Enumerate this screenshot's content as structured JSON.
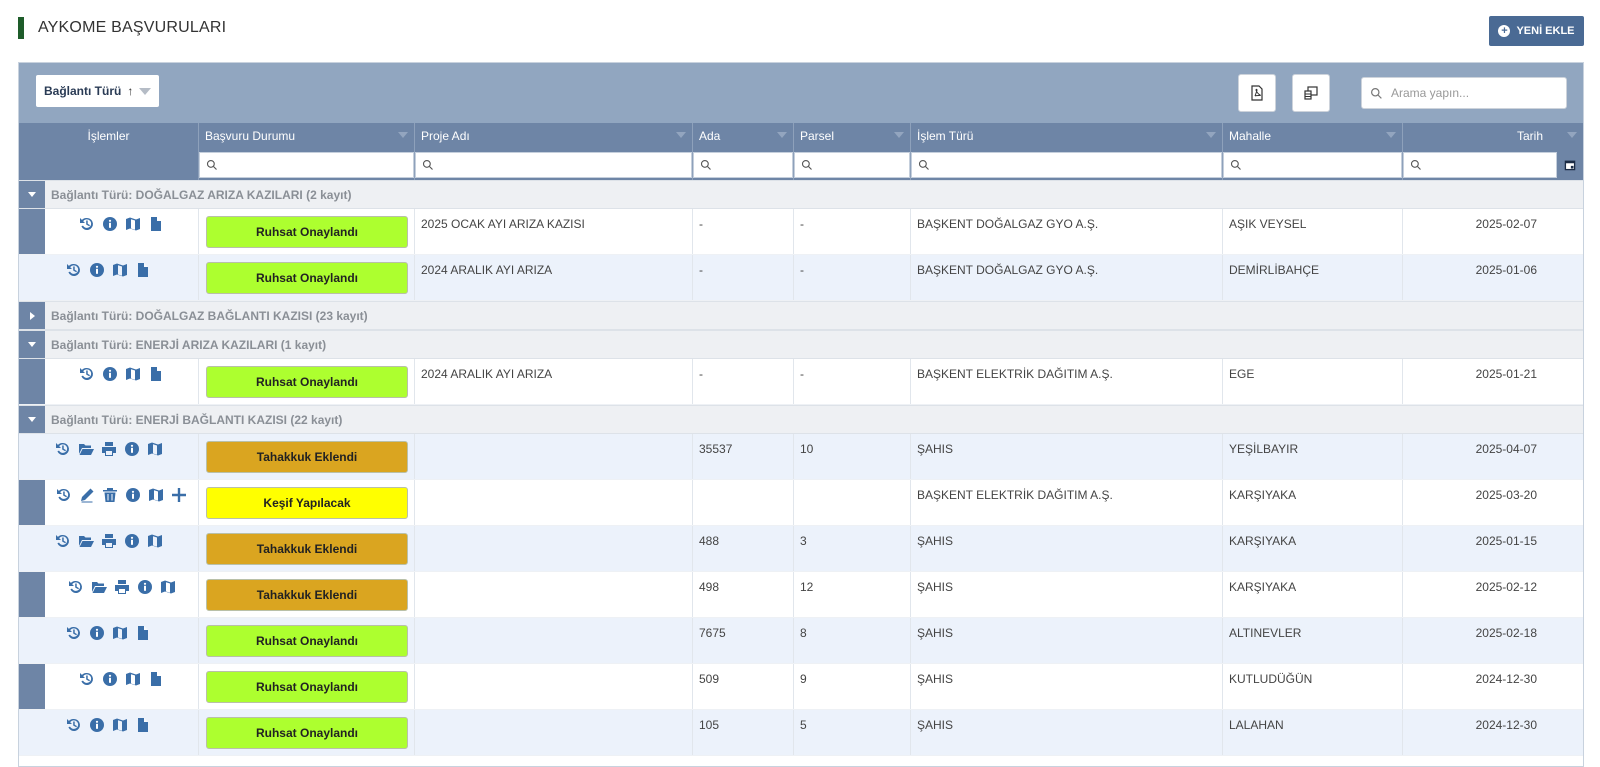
{
  "page": {
    "title": "AYKOME BAŞVURULARI",
    "new_button": "YENİ EKLE"
  },
  "toolbar": {
    "group_chip_label": "Bağlantı Türü",
    "group_chip_sort": "↑",
    "search_placeholder": "Arama yapın..."
  },
  "columns": {
    "islemler": "İşlemler",
    "basvuru_durumu": "Başvuru Durumu",
    "proje_adi": "Proje Adı",
    "ada": "Ada",
    "parsel": "Parsel",
    "islem_turu": "İşlem Türü",
    "mahalle": "Mahalle",
    "tarih": "Tarih"
  },
  "groups": [
    {
      "label": "Bağlantı Türü: DOĞALGAZ ARIZA KAZILARI (2 kayıt)",
      "expanded": true,
      "rows": [
        {
          "icons": [
            "history",
            "info",
            "map",
            "file"
          ],
          "status": "Ruhsat Onaylandı",
          "status_color": "#adff2f",
          "proje": "2025 OCAK AYI ARIZA KAZISI",
          "ada": "-",
          "parsel": "-",
          "islem": "BAŞKENT DOĞALGAZ GYO A.Ş.",
          "mahalle": "AŞIK VEYSEL",
          "tarih": "2025-02-07"
        },
        {
          "icons": [
            "history",
            "info",
            "map",
            "file"
          ],
          "status": "Ruhsat Onaylandı",
          "status_color": "#adff2f",
          "proje": "2024 ARALIK AYI ARIZA",
          "ada": "-",
          "parsel": "-",
          "islem": "BAŞKENT DOĞALGAZ GYO A.Ş.",
          "mahalle": "DEMİRLİBAHÇE",
          "tarih": "2025-01-06"
        }
      ]
    },
    {
      "label": "Bağlantı Türü: DOĞALGAZ BAĞLANTI KAZISI (23 kayıt)",
      "expanded": false,
      "rows": []
    },
    {
      "label": "Bağlantı Türü: ENERJİ ARIZA KAZILARI (1 kayıt)",
      "expanded": true,
      "rows": [
        {
          "icons": [
            "history",
            "info",
            "map",
            "file"
          ],
          "status": "Ruhsat Onaylandı",
          "status_color": "#adff2f",
          "proje": "2024 ARALIK AYI ARIZA",
          "ada": "-",
          "parsel": "-",
          "islem": "BAŞKENT ELEKTRİK DAĞITIM A.Ş.",
          "mahalle": "EGE",
          "tarih": "2025-01-21"
        }
      ]
    },
    {
      "label": "Bağlantı Türü: ENERJİ BAĞLANTI KAZISI (22 kayıt)",
      "expanded": true,
      "rows": [
        {
          "icons": [
            "history",
            "folder-open",
            "print",
            "info",
            "map"
          ],
          "status": "Tahakkuk Eklendi",
          "status_color": "#daa520",
          "proje": "",
          "ada": "35537",
          "parsel": "10",
          "islem": "ŞAHIS",
          "mahalle": "YEŞİLBAYIR",
          "tarih": "2025-04-07"
        },
        {
          "icons": [
            "history",
            "edit",
            "trash",
            "info",
            "map",
            "plus"
          ],
          "status": "Keşif Yapılacak",
          "status_color": "#ffff00",
          "proje": "",
          "ada": "",
          "parsel": "",
          "islem": "BAŞKENT ELEKTRİK DAĞITIM A.Ş.",
          "mahalle": "KARŞIYAKA",
          "tarih": "2025-03-20"
        },
        {
          "icons": [
            "history",
            "folder-open",
            "print",
            "info",
            "map"
          ],
          "status": "Tahakkuk Eklendi",
          "status_color": "#daa520",
          "proje": "",
          "ada": "488",
          "parsel": "3",
          "islem": "ŞAHIS",
          "mahalle": "KARŞIYAKA",
          "tarih": "2025-01-15"
        },
        {
          "icons": [
            "history",
            "folder-open",
            "print",
            "info",
            "map"
          ],
          "status": "Tahakkuk Eklendi",
          "status_color": "#daa520",
          "proje": "",
          "ada": "498",
          "parsel": "12",
          "islem": "ŞAHIS",
          "mahalle": "KARŞIYAKA",
          "tarih": "2025-02-12"
        },
        {
          "icons": [
            "history",
            "info",
            "map",
            "file"
          ],
          "status": "Ruhsat Onaylandı",
          "status_color": "#adff2f",
          "proje": "",
          "ada": "7675",
          "parsel": "8",
          "islem": "ŞAHIS",
          "mahalle": "ALTINEVLER",
          "tarih": "2025-02-18"
        },
        {
          "icons": [
            "history",
            "info",
            "map",
            "file"
          ],
          "status": "Ruhsat Onaylandı",
          "status_color": "#adff2f",
          "proje": "",
          "ada": "509",
          "parsel": "9",
          "islem": "ŞAHIS",
          "mahalle": "KUTLUDÜĞÜN",
          "tarih": "2024-12-30"
        },
        {
          "icons": [
            "history",
            "info",
            "map",
            "file"
          ],
          "status": "Ruhsat Onaylandı",
          "status_color": "#adff2f",
          "proje": "",
          "ada": "105",
          "parsel": "5",
          "islem": "ŞAHIS",
          "mahalle": "LALAHAN",
          "tarih": "2024-12-30"
        }
      ]
    }
  ]
}
